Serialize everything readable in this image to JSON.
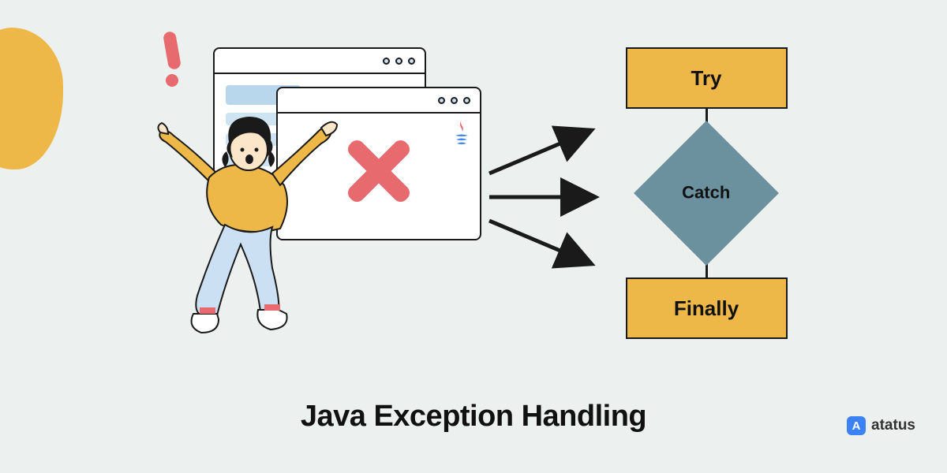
{
  "title": "Java Exception Handling",
  "flow": {
    "try": "Try",
    "catch": "Catch",
    "finally": "Finally"
  },
  "brand": {
    "name": "atatus",
    "logo_letter": "A"
  },
  "icons": {
    "exclamation": "exclamation-icon",
    "error_x": "error-x-icon",
    "java": "java-logo-icon",
    "blob": "decorative-blob"
  },
  "colors": {
    "accent_yellow": "#eeb848",
    "accent_red": "#e76a6f",
    "accent_teal": "#6a919d",
    "bg": "#ecf0ef",
    "brand_blue": "#3b82f6"
  }
}
